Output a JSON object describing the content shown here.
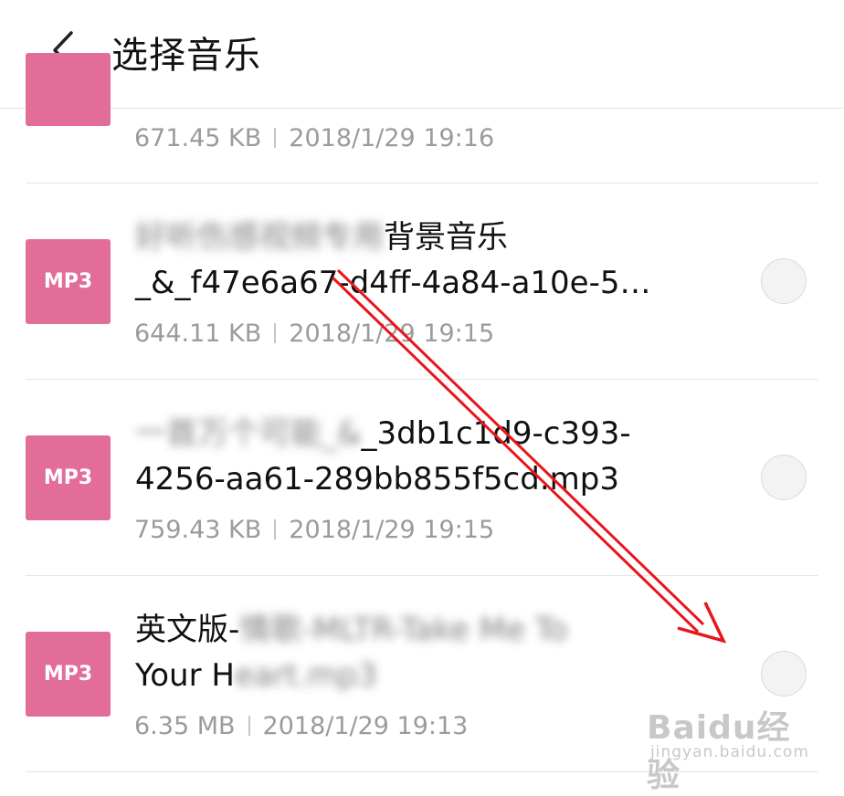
{
  "header": {
    "title": "选择音乐"
  },
  "list": [
    {
      "badge": "",
      "name_line1": "",
      "name_line2": "",
      "size": "671.45 KB",
      "date": "2018/1/29 19:16"
    },
    {
      "badge": "MP3",
      "name_line1_blurred": "好听伤感视频专用",
      "name_line1": "背景音乐",
      "name_line2": "_&_f47e6a67-d4ff-4a84-a10e-5…",
      "size": "644.11 KB",
      "date": "2018/1/29 19:15"
    },
    {
      "badge": "MP3",
      "name_line1_blurred": "一首万个可能_&",
      "name_line1": "_3db1c1d9-c393-",
      "name_line2": "4256-aa61-289bb855f5cd.mp3",
      "size": "759.43 KB",
      "date": "2018/1/29 19:15"
    },
    {
      "badge": "MP3",
      "name_line1": "英文版-",
      "name_line1_blurred": "情歌-MLTR-Take Me To",
      "name_line2": "Your H",
      "name_line2_blurred": "eart.mp3",
      "size": "6.35 MB",
      "date": "2018/1/29 19:13"
    }
  ],
  "watermark": {
    "main": "Baidu经验",
    "sub": "jingyan.baidu.com"
  },
  "colors": {
    "badge": "#e26d98",
    "annotation_arrow": "#e8161c",
    "meta_text": "#9b9b9b"
  }
}
